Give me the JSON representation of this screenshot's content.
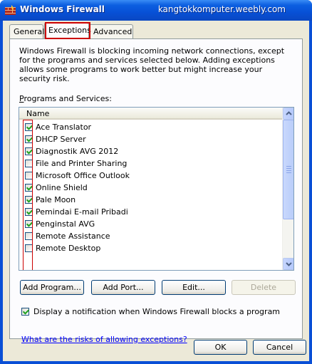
{
  "window": {
    "title": "Windows Firewall",
    "watermark": "kangtokkomputer.weebly.com"
  },
  "tabs": [
    {
      "label": "General",
      "selected": false
    },
    {
      "label": "Exceptions",
      "selected": true
    },
    {
      "label": "Advanced",
      "selected": false
    }
  ],
  "intro_text": "Windows Firewall is blocking incoming network connections, except for the programs and services selected below. Adding exceptions allows some programs to work better but might increase your security risk.",
  "section_label": "Programs and Services:",
  "list": {
    "column_header": "Name",
    "items": [
      {
        "label": "Ace Translator",
        "checked": true
      },
      {
        "label": "DHCP Server",
        "checked": true
      },
      {
        "label": "Diagnostik AVG 2012",
        "checked": true
      },
      {
        "label": "File and Printer Sharing",
        "checked": false
      },
      {
        "label": "Microsoft Office Outlook",
        "checked": false
      },
      {
        "label": "Online Shield",
        "checked": true
      },
      {
        "label": "Pale Moon",
        "checked": true
      },
      {
        "label": "Pemindai E-mail Pribadi",
        "checked": true
      },
      {
        "label": "Penginstal AVG",
        "checked": true
      },
      {
        "label": "Remote Assistance",
        "checked": false
      },
      {
        "label": "Remote Desktop",
        "checked": false
      }
    ]
  },
  "buttons": {
    "add_program": "Add Program...",
    "add_port": "Add Port...",
    "edit": "Edit...",
    "delete": "Delete",
    "ok": "OK",
    "cancel": "Cancel"
  },
  "notify": {
    "label": "Display a notification when Windows Firewall blocks a program",
    "checked": true
  },
  "risk_link": "What are the risks of allowing exceptions?",
  "icons": {
    "title": "firewall-icon",
    "scroll_up": "chevron-up-icon",
    "scroll_down": "chevron-down-icon"
  },
  "colors": {
    "titlebar": "#0a4fd6",
    "dialog_face": "#ece9d8",
    "link": "#0000ff",
    "annotation_red": "#cc0000"
  }
}
